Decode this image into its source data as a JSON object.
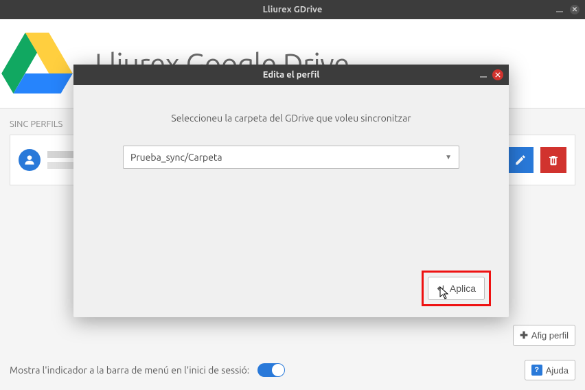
{
  "main_window": {
    "title": "Lliurex GDrive",
    "banner_title": "Lliurex Google Drive",
    "section_label": "SINC PERFILS",
    "indicator_label": "Mostra l'indicador a la barra de menú en l'inici de sessió:",
    "add_profile_label": "Afig perfil",
    "help_label": "Ajuda"
  },
  "dialog": {
    "title": "Edita el perfil",
    "instruction": "Seleccioneu la carpeta del GDrive que voleu sincronitzar",
    "selected_folder": "Prueba_sync/Carpeta",
    "apply_label": "Aplica"
  }
}
